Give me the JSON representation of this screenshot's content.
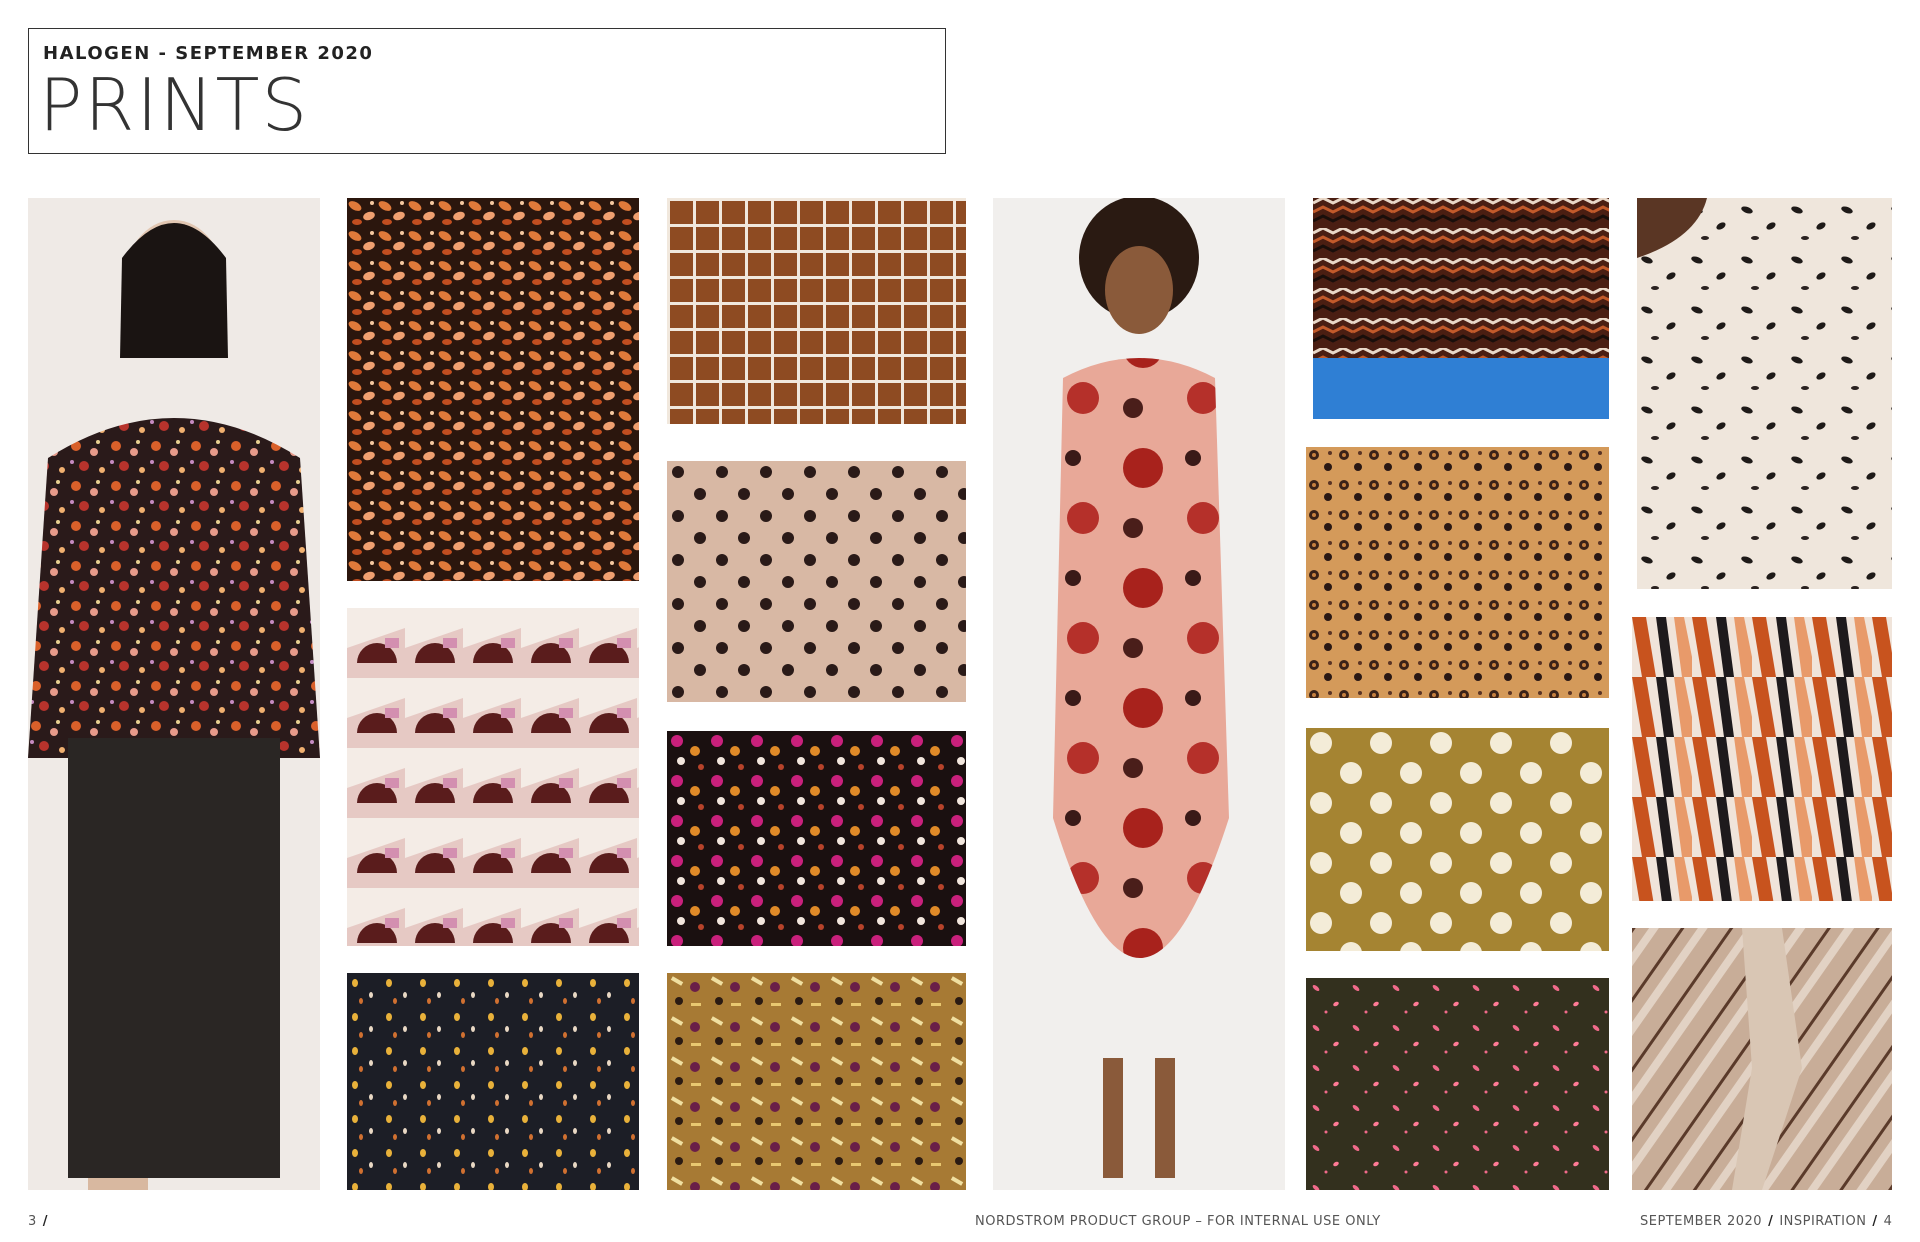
{
  "header": {
    "subtitle": "HALOGEN - SEPTEMBER 2020",
    "title": "PRINTS"
  },
  "tiles": [
    {
      "id": "model-floral-blouse-leather-skirt",
      "icon": "photo-model-floral-blouse"
    },
    {
      "id": "orange-ditsy-floral",
      "icon": "photo-orange-floral-print"
    },
    {
      "id": "brown-grid-check",
      "icon": "photo-grid-print"
    },
    {
      "id": "blush-polka-dot",
      "icon": "photo-polka-dot-print"
    },
    {
      "id": "geometric-half-circle",
      "icon": "photo-geometric-print"
    },
    {
      "id": "magenta-floral",
      "icon": "photo-magenta-floral-print"
    },
    {
      "id": "black-confetti-dot",
      "icon": "photo-confetti-print"
    },
    {
      "id": "mustard-abstract-floral",
      "icon": "photo-mustard-floral-print"
    },
    {
      "id": "model-red-floral-dress",
      "icon": "photo-model-floral-dress"
    },
    {
      "id": "zigzag-stripe-shirt",
      "icon": "photo-zigzag-print"
    },
    {
      "id": "leopard-print",
      "icon": "photo-leopard-print"
    },
    {
      "id": "olive-polka-dot",
      "icon": "photo-large-dot-print"
    },
    {
      "id": "pink-petal-on-green",
      "icon": "photo-petal-print"
    },
    {
      "id": "dalmatian-spot",
      "icon": "photo-dalmatian-print"
    },
    {
      "id": "rust-abstract-stroke",
      "icon": "photo-abstract-print"
    },
    {
      "id": "diagonal-stripe-bow-blouse",
      "icon": "photo-stripe-bow-blouse"
    }
  ],
  "footer": {
    "page_left": "3",
    "center": "NORDSTROM PRODUCT GROUP – FOR INTERNAL USE ONLY",
    "right_date": "SEPTEMBER 2020",
    "right_section": "INSPIRATION",
    "page_right": "4"
  },
  "colors": {
    "border": "#333333",
    "background": "#ffffff"
  }
}
